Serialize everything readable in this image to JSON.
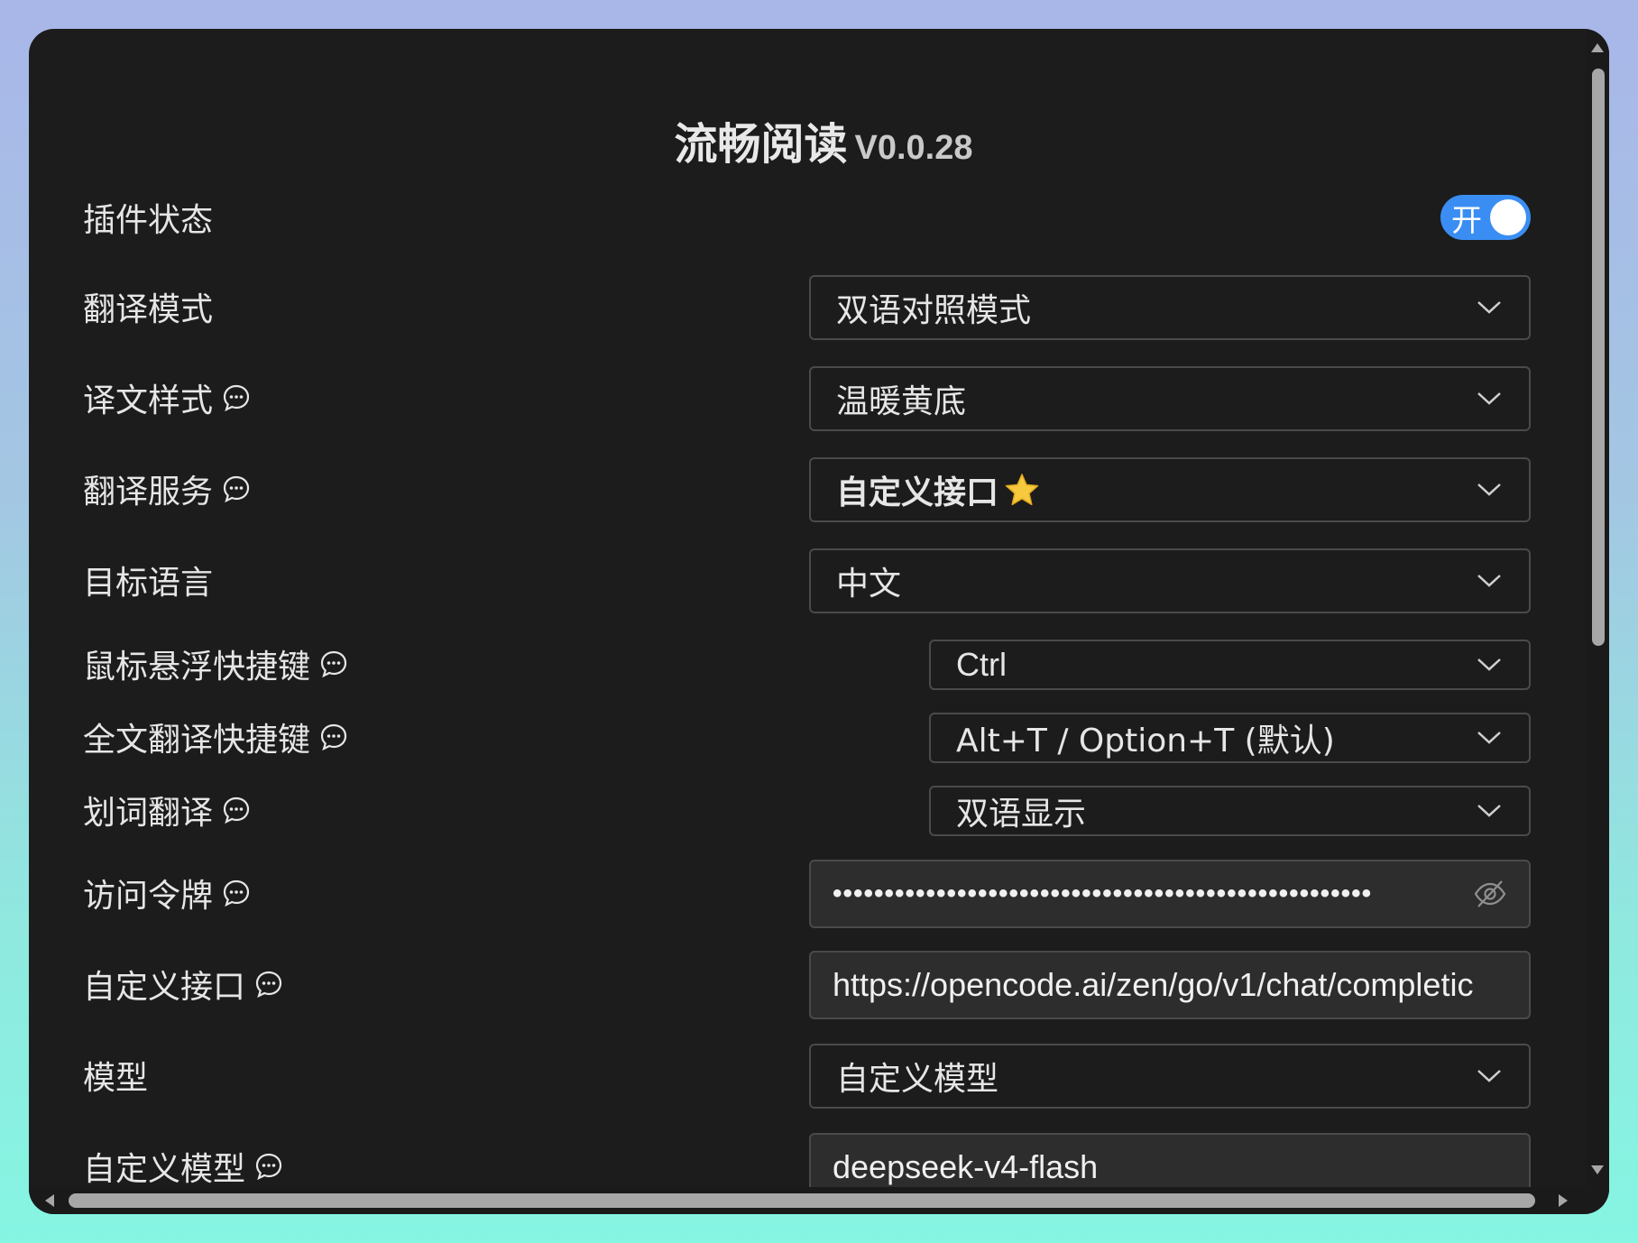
{
  "header": {
    "title": "流畅阅读",
    "version": "V0.0.28"
  },
  "plugin_status": {
    "label": "插件状态",
    "toggle_text": "开",
    "enabled": true
  },
  "settings": {
    "translate_mode": {
      "label": "翻译模式",
      "value": "双语对照模式"
    },
    "translation_style": {
      "label": "译文样式",
      "value": "温暖黄底"
    },
    "translation_service": {
      "label": "翻译服务",
      "value": "自定义接口"
    },
    "target_language": {
      "label": "目标语言",
      "value": "中文"
    },
    "hover_shortcut": {
      "label": "鼠标悬浮快捷键",
      "value": "Ctrl"
    },
    "fulltext_shortcut": {
      "label": "全文翻译快捷键",
      "value": "Alt+T / Option+T (默认)"
    },
    "selection_translate": {
      "label": "划词翻译",
      "value": "双语显示"
    },
    "access_token": {
      "label": "访问令牌",
      "value": "••••••••••••••••••••••••••••••••••••••••••••••••••••"
    },
    "custom_endpoint": {
      "label": "自定义接口",
      "value": "https://opencode.ai/zen/go/v1/chat/completic"
    },
    "model": {
      "label": "模型",
      "value": "自定义模型"
    },
    "custom_model": {
      "label": "自定义模型",
      "value": "deepseek-v4-flash"
    }
  },
  "colors": {
    "accent": "#3a8ef3",
    "panel_bg": "#1c1c1c",
    "input_bg": "#2d2d2d",
    "border": "#4a4a4a"
  },
  "icons": [
    "info-icon",
    "chevron-down-icon",
    "star-icon",
    "eye-off-icon"
  ]
}
